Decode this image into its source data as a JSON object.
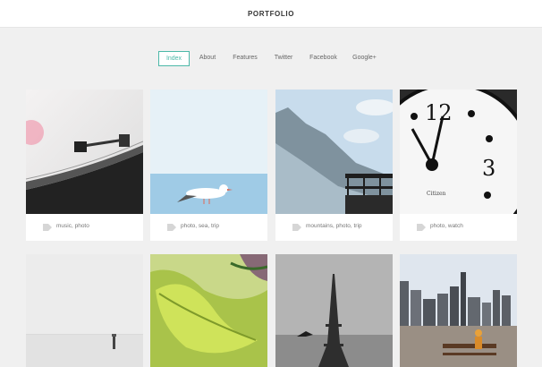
{
  "header": {
    "title": "PORTFOLIO"
  },
  "nav": {
    "items": [
      {
        "label": "Index",
        "active": true
      },
      {
        "label": "About"
      },
      {
        "label": "Features"
      },
      {
        "label": "Twitter"
      },
      {
        "label": "Facebook"
      },
      {
        "label": "Google+"
      }
    ]
  },
  "portfolio": {
    "items": [
      {
        "tags": "music, photo",
        "icon": "tag-icon"
      },
      {
        "tags": "photo, sea, trip",
        "icon": "tag-icon"
      },
      {
        "tags": "mountains, photo, trip",
        "icon": "tag-icon"
      },
      {
        "tags": "photo, watch",
        "icon": "tag-icon"
      }
    ]
  },
  "colors": {
    "accent": "#4cb8a8",
    "background": "#f0f0f0",
    "card": "#ffffff"
  }
}
